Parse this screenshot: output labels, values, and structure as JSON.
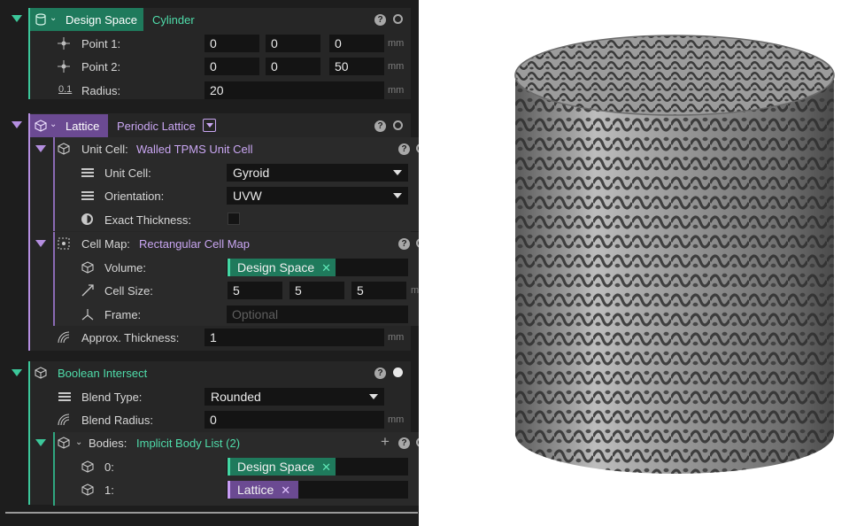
{
  "design_space": {
    "header_label": "Design Space",
    "type_label": "Cylinder",
    "point1": {
      "label": "Point 1:",
      "x": "0",
      "y": "0",
      "z": "0",
      "unit": "mm"
    },
    "point2": {
      "label": "Point 2:",
      "x": "0",
      "y": "0",
      "z": "50",
      "unit": "mm"
    },
    "radius": {
      "label": "Radius:",
      "value": "20",
      "unit": "mm"
    }
  },
  "lattice": {
    "header_label": "Lattice",
    "type_label": "Periodic Lattice",
    "unit_cell": {
      "label": "Unit Cell:",
      "type_label": "Walled TPMS Unit Cell",
      "unit_cell_field": {
        "label": "Unit Cell:",
        "value": "Gyroid"
      },
      "orientation": {
        "label": "Orientation:",
        "value": "UVW"
      },
      "exact_thickness": {
        "label": "Exact Thickness:",
        "checked": false
      }
    },
    "cell_map": {
      "label": "Cell Map:",
      "type_label": "Rectangular Cell Map",
      "volume": {
        "label": "Volume:",
        "value": "Design Space"
      },
      "cell_size": {
        "label": "Cell Size:",
        "x": "5",
        "y": "5",
        "z": "5",
        "unit": "mm"
      },
      "frame": {
        "label": "Frame:",
        "placeholder": "Optional"
      }
    },
    "approx_thickness": {
      "label": "Approx. Thickness:",
      "value": "1",
      "unit": "mm"
    }
  },
  "boolean": {
    "header_label": "Boolean Intersect",
    "blend_type": {
      "label": "Blend Type:",
      "value": "Rounded"
    },
    "blend_radius": {
      "label": "Blend Radius:",
      "value": "0",
      "unit": "mm"
    },
    "bodies": {
      "label": "Bodies:",
      "type_label": "Implicit Body List (2)",
      "items": [
        {
          "index": "0:",
          "value": "Design Space"
        },
        {
          "index": "1:",
          "value": "Lattice"
        }
      ]
    }
  },
  "icons": {
    "help": "?",
    "close": "✕",
    "add": "+"
  },
  "colors": {
    "design_space_accent": "#3cc79a",
    "lattice_accent": "#b48ee0",
    "panel_bg": "#1d1d1d"
  }
}
